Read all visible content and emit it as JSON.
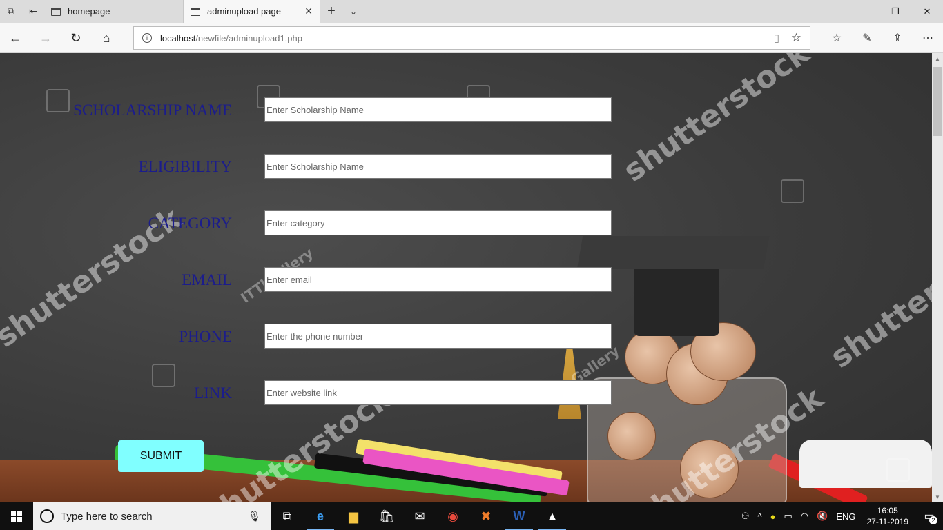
{
  "browser": {
    "tabs": [
      {
        "title": "homepage",
        "active": false
      },
      {
        "title": "adminupload page",
        "active": true
      }
    ],
    "url_host": "localhost",
    "url_path": "/newfile/adminupload1.php"
  },
  "form": {
    "fields": [
      {
        "label": "SCHOLARSHIP NAME",
        "placeholder": "Enter Scholarship Name"
      },
      {
        "label": "ELIGIBILITY",
        "placeholder": "Enter Scholarship Name"
      },
      {
        "label": "CATEGORY",
        "placeholder": "Enter category"
      },
      {
        "label": "EMAIL",
        "placeholder": "Enter email"
      },
      {
        "label": "PHONE",
        "placeholder": "Enter the phone number"
      },
      {
        "label": "LINK",
        "placeholder": "Enter website link"
      }
    ],
    "submit_label": "SUBMIT",
    "label_color": "#1b1c8c",
    "submit_color": "#80ffff"
  },
  "background": {
    "watermark_text": "shutterstock",
    "watermark_small": "ITTlGallery",
    "watermark_small_2": "Gallery"
  },
  "taskbar": {
    "search_placeholder": "Type here to search",
    "language": "ENG",
    "time": "16:05",
    "date": "27-11-2019",
    "notification_count": "2"
  }
}
